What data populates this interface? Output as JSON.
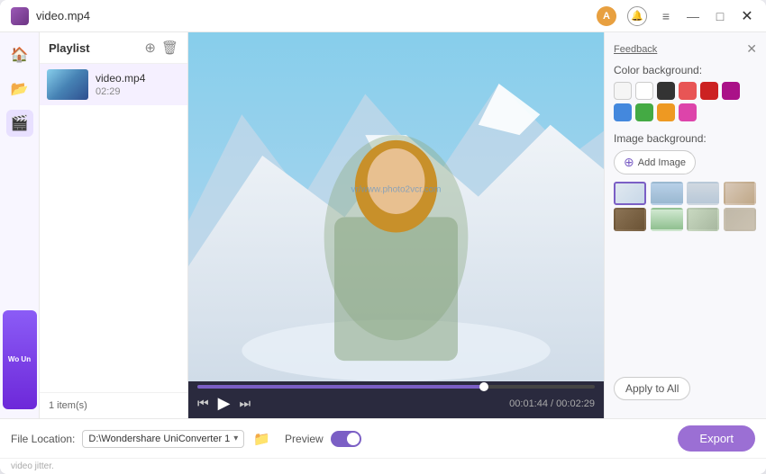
{
  "titleBar": {
    "title": "video.mp4",
    "minimize": "—",
    "maximize": "□",
    "close": "✕",
    "feedback": "Feedback"
  },
  "sidebar": {
    "icons": [
      "🏠",
      "📂",
      "🎬"
    ],
    "banner": {
      "text": "Wo\nUn"
    }
  },
  "playlist": {
    "title": "Playlist",
    "items": [
      {
        "name": "video.mp4",
        "duration": "02:29"
      }
    ],
    "count": "1 item(s)"
  },
  "video": {
    "watermark": "vr/www.photo2vcr.com",
    "currentTime": "00:01:44",
    "totalTime": "00:02:29",
    "progressPercent": 72
  },
  "rightPanel": {
    "feedbackLabel": "Feedback",
    "colorBgLabel": "Color background:",
    "imageBgLabel": "Image background:",
    "addImageLabel": "Add Image",
    "applyToAllLabel": "Apply to All",
    "colors": [
      {
        "hex": "#f5f5f5",
        "selected": false
      },
      {
        "hex": "#ffffff",
        "selected": false
      },
      {
        "hex": "#333333",
        "selected": false
      },
      {
        "hex": "#e85555",
        "selected": false
      },
      {
        "hex": "#cc2222",
        "selected": false
      },
      {
        "hex": "#aa1188",
        "selected": false
      },
      {
        "hex": "#4488dd",
        "selected": false
      },
      {
        "hex": "#44aa44",
        "selected": false
      },
      {
        "hex": "#ee9922",
        "selected": false
      },
      {
        "hex": "#dd44aa",
        "selected": false
      }
    ]
  },
  "bottomBar": {
    "fileLocationLabel": "File Location:",
    "fileLocationValue": "D:\\Wondershare UniConverter 1",
    "previewLabel": "Preview",
    "exportLabel": "Export"
  },
  "tipBar": {
    "text": "video jitter."
  }
}
